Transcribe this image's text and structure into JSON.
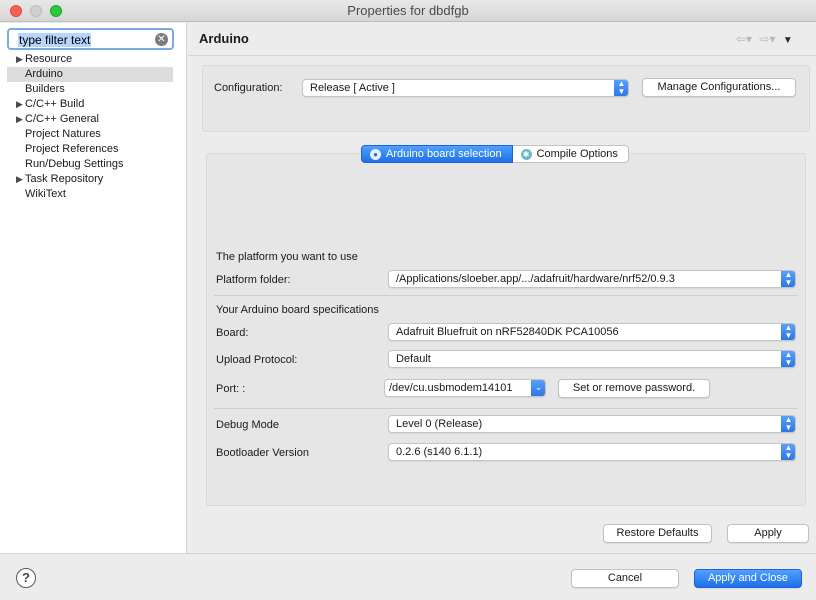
{
  "window": {
    "title": "Properties for dbdfgb"
  },
  "filter": {
    "placeholder": "type filter text"
  },
  "tree": {
    "items": [
      {
        "label": "Resource",
        "expandable": true,
        "selected": false
      },
      {
        "label": "Arduino",
        "expandable": false,
        "selected": true
      },
      {
        "label": "Builders",
        "expandable": false,
        "selected": false
      },
      {
        "label": "C/C++ Build",
        "expandable": true,
        "selected": false
      },
      {
        "label": "C/C++ General",
        "expandable": true,
        "selected": false
      },
      {
        "label": "Project Natures",
        "expandable": false,
        "selected": false
      },
      {
        "label": "Project References",
        "expandable": false,
        "selected": false
      },
      {
        "label": "Run/Debug Settings",
        "expandable": false,
        "selected": false
      },
      {
        "label": "Task Repository",
        "expandable": true,
        "selected": false
      },
      {
        "label": "WikiText",
        "expandable": false,
        "selected": false
      }
    ]
  },
  "page": {
    "title": "Arduino"
  },
  "config": {
    "label": "Configuration:",
    "value": "Release  [ Active ]",
    "manage_label": "Manage Configurations..."
  },
  "tabs": {
    "board": "Arduino board selection",
    "compile": "Compile Options"
  },
  "platform": {
    "heading": "The platform you want to use",
    "folder_label": "Platform folder:",
    "folder_value": "/Applications/sloeber.app/.../adafruit/hardware/nrf52/0.9.3"
  },
  "board": {
    "heading": "Your Arduino board specifications",
    "board_label": "Board:",
    "board_value": "Adafruit Bluefruit on nRF52840DK PCA10056",
    "upload_label": "Upload Protocol:",
    "upload_value": "Default",
    "port_label": "Port: :",
    "port_value": "/dev/cu.usbmodem14101",
    "password_label": "Set or remove password."
  },
  "debug": {
    "mode_label": "Debug Mode",
    "mode_value": "Level 0 (Release)",
    "bootloader_label": "Bootloader Version",
    "bootloader_value": "0.2.6 (s140 6.1.1)"
  },
  "buttons": {
    "restore": "Restore Defaults",
    "apply": "Apply",
    "cancel": "Cancel",
    "apply_close": "Apply and Close"
  },
  "colors": {
    "accent": "#1e6fe8",
    "selection": "#dcdcdc"
  }
}
